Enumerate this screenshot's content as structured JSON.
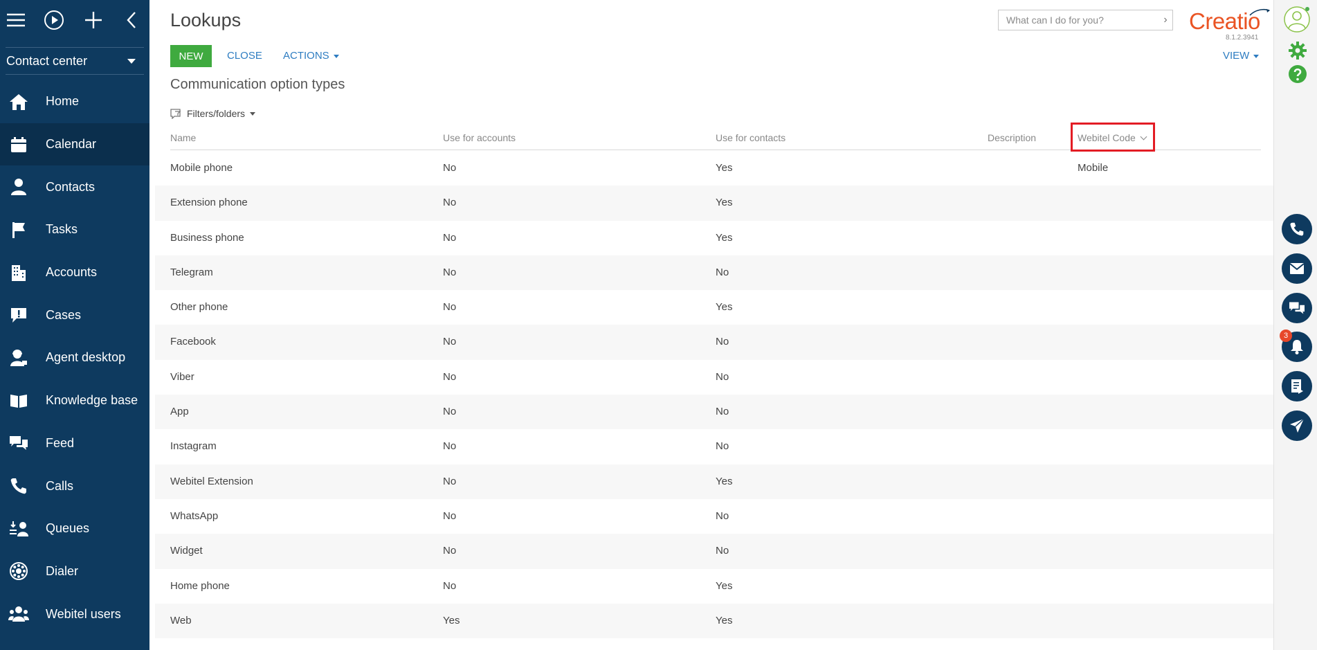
{
  "sidebar": {
    "workspace": "Contact center",
    "items": [
      {
        "label": "Home",
        "icon": "home-icon"
      },
      {
        "label": "Calendar",
        "icon": "calendar-icon"
      },
      {
        "label": "Contacts",
        "icon": "person-icon"
      },
      {
        "label": "Tasks",
        "icon": "flag-icon"
      },
      {
        "label": "Accounts",
        "icon": "building-icon"
      },
      {
        "label": "Cases",
        "icon": "chat-exclamation-icon"
      },
      {
        "label": "Agent desktop",
        "icon": "agent-icon"
      },
      {
        "label": "Knowledge base",
        "icon": "book-icon"
      },
      {
        "label": "Feed",
        "icon": "chat-bubbles-icon"
      },
      {
        "label": "Calls",
        "icon": "phone-icon"
      },
      {
        "label": "Queues",
        "icon": "queue-icon"
      },
      {
        "label": "Dialer",
        "icon": "dialer-icon"
      },
      {
        "label": "Webitel users",
        "icon": "users-icon"
      }
    ],
    "active_index": 1
  },
  "header": {
    "title": "Lookups",
    "search_placeholder": "What can I do for you?",
    "logo_text": "Creatio",
    "version": "8.1.2.3941"
  },
  "toolbar": {
    "new_label": "NEW",
    "close_label": "CLOSE",
    "actions_label": "ACTIONS",
    "view_label": "VIEW"
  },
  "section": {
    "subtitle": "Communication option types",
    "filters_label": "Filters/folders"
  },
  "grid": {
    "columns": [
      "Name",
      "Use for accounts",
      "Use for contacts",
      "Description",
      "Webitel Code"
    ],
    "rows": [
      [
        "Mobile phone",
        "No",
        "Yes",
        "",
        "Mobile"
      ],
      [
        "Extension phone",
        "No",
        "Yes",
        "",
        ""
      ],
      [
        "Business phone",
        "No",
        "Yes",
        "",
        ""
      ],
      [
        "Telegram",
        "No",
        "No",
        "",
        ""
      ],
      [
        "Other phone",
        "No",
        "Yes",
        "",
        ""
      ],
      [
        "Facebook",
        "No",
        "No",
        "",
        ""
      ],
      [
        "Viber",
        "No",
        "No",
        "",
        ""
      ],
      [
        "App",
        "No",
        "No",
        "",
        ""
      ],
      [
        "Instagram",
        "No",
        "No",
        "",
        ""
      ],
      [
        "Webitel Extension",
        "No",
        "Yes",
        "",
        ""
      ],
      [
        "WhatsApp",
        "No",
        "No",
        "",
        ""
      ],
      [
        "Widget",
        "No",
        "No",
        "",
        ""
      ],
      [
        "Home phone",
        "No",
        "Yes",
        "",
        ""
      ],
      [
        "Web",
        "Yes",
        "Yes",
        "",
        ""
      ]
    ]
  },
  "rail": {
    "notification_count": "3",
    "buttons": [
      "phone-icon",
      "mail-icon",
      "chat-icon",
      "bell-icon",
      "document-icon",
      "send-icon"
    ]
  },
  "colors": {
    "sidebar_bg": "#0e3a5f",
    "accent_green": "#3faa3f",
    "link_blue": "#2d7cc1",
    "logo_orange": "#ea5424",
    "highlight_red": "#e31c24"
  }
}
